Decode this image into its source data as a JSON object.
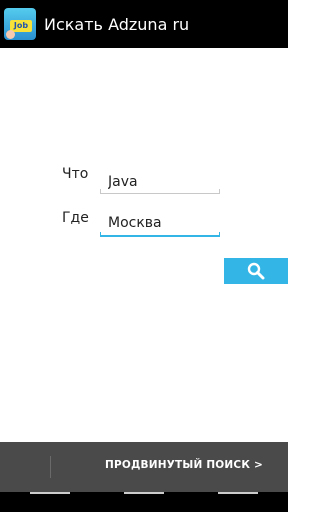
{
  "app": {
    "title": "Искать Adzuna ru",
    "icon": "app-logo-icon",
    "icon_text": "Job"
  },
  "form": {
    "what": {
      "label": "Что",
      "value": "Java"
    },
    "where": {
      "label": "Где",
      "value": "Москва"
    }
  },
  "search_button": {
    "icon": "search-icon",
    "color": "#33b5e5"
  },
  "bottom_bar": {
    "advanced_search_label": "ПРОДВИНУТЫЙ ПОИСК >"
  },
  "colors": {
    "accent": "#33b5e5",
    "action_bar": "#000000",
    "bottom_bar": "#4a4a4a"
  }
}
